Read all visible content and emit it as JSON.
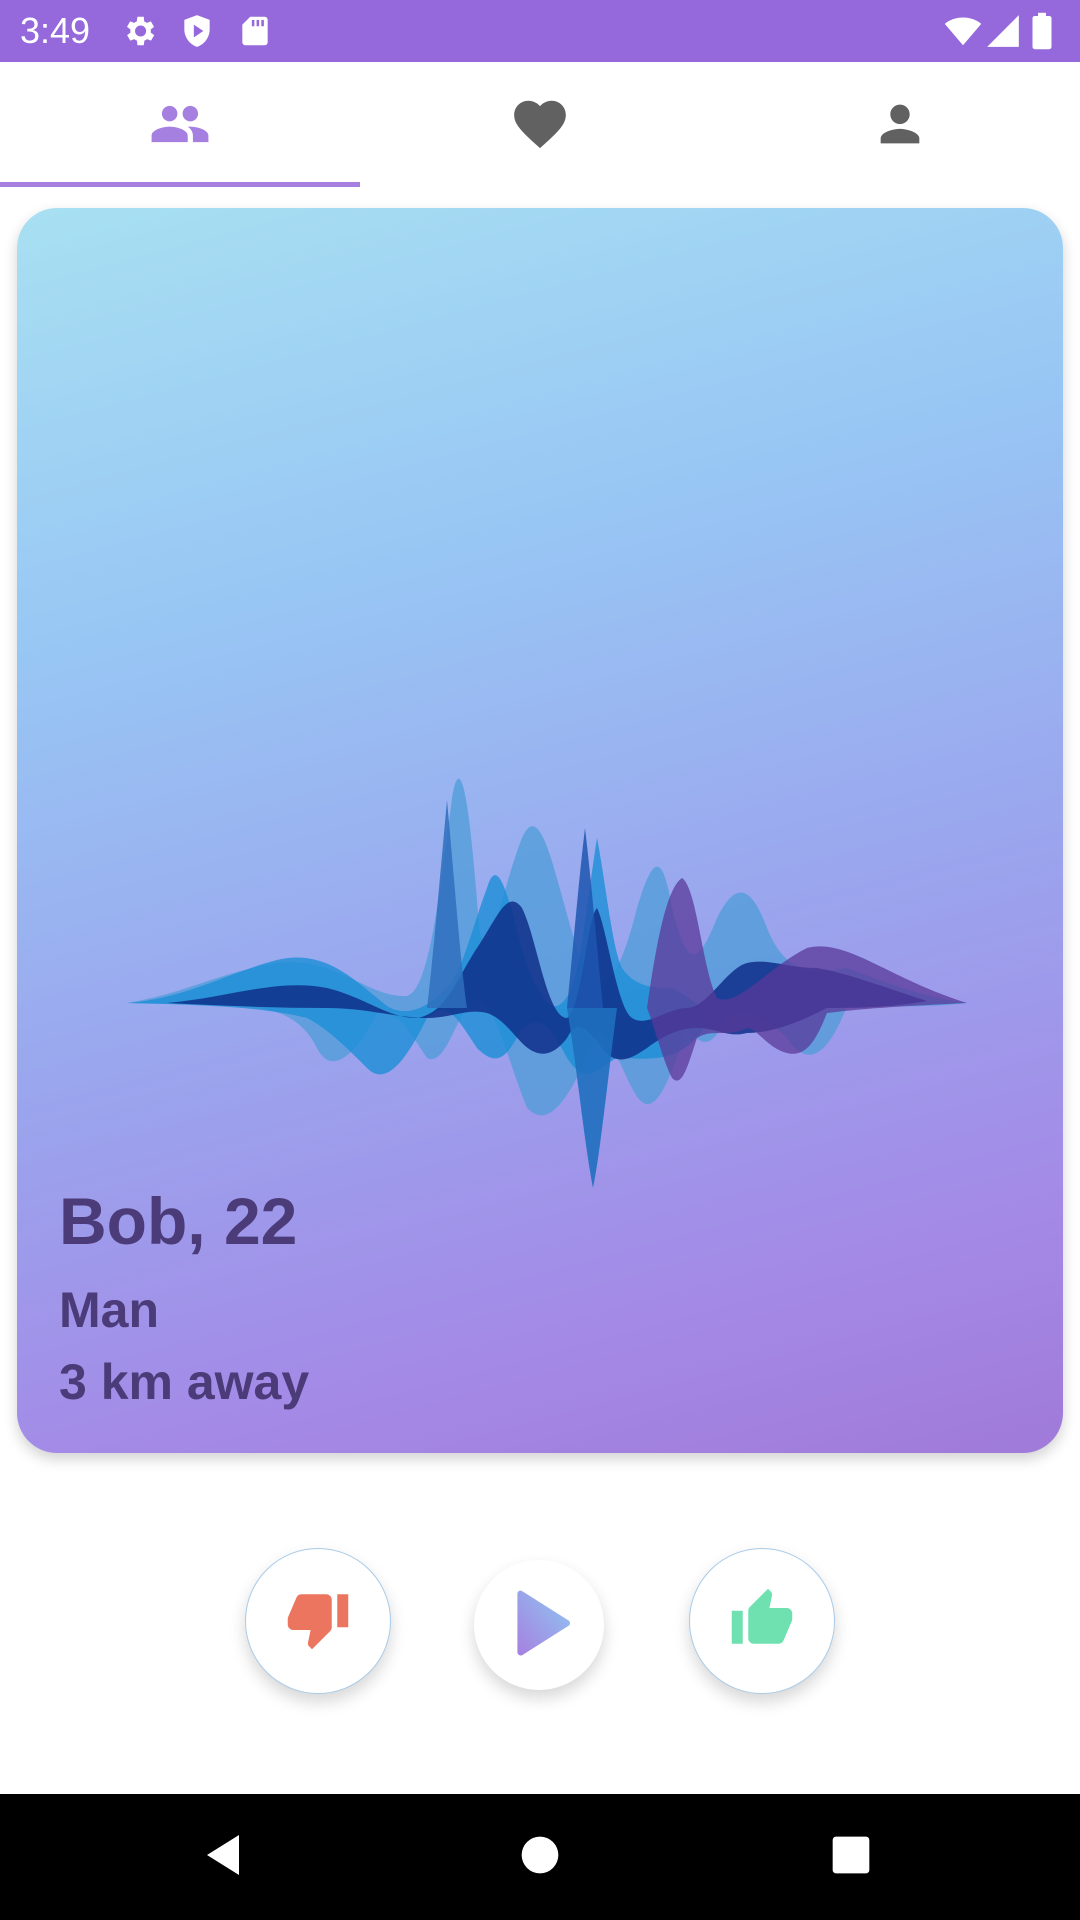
{
  "status_bar": {
    "time": "3:49",
    "left_icons": [
      "settings-icon",
      "shield-play-icon",
      "sd-card-icon"
    ],
    "right_icons": [
      "wifi-icon",
      "cell-signal-icon",
      "battery-icon"
    ],
    "background": "#9569dc"
  },
  "tabs": [
    {
      "name": "people-icon",
      "active": true,
      "color": "#a680e0"
    },
    {
      "name": "heart-icon",
      "active": false,
      "color": "#616161"
    },
    {
      "name": "person-icon",
      "active": false,
      "color": "#616161"
    }
  ],
  "profile": {
    "name_age": "Bob, 22",
    "gender": "Man",
    "distance": "3 km away",
    "image": "sound-wave-icon"
  },
  "actions": {
    "dislike": {
      "icon": "thumbs-down-icon",
      "color": "#ec7560"
    },
    "play": {
      "icon": "play-icon"
    },
    "like": {
      "icon": "thumbs-up-icon",
      "color": "#6fe0b0"
    }
  },
  "system_nav": [
    "back-icon",
    "home-icon",
    "recents-icon"
  ]
}
